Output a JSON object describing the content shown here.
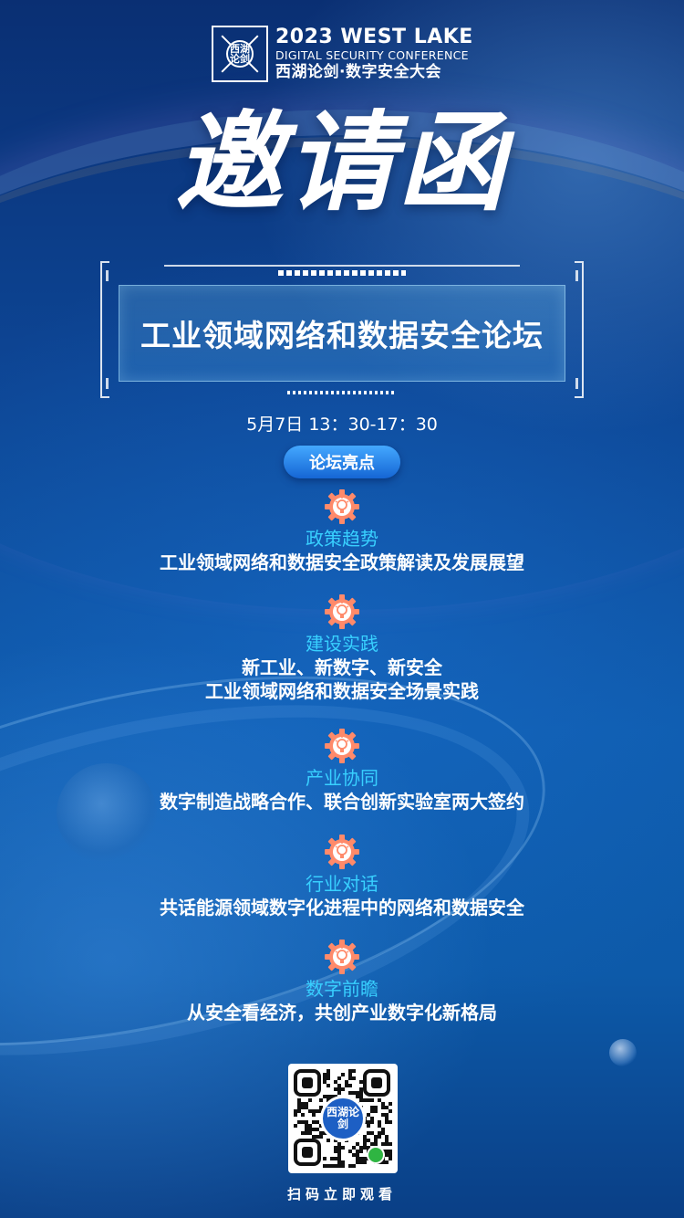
{
  "header": {
    "year": "2023",
    "line1_rest": "WEST LAKE",
    "line2": "DIGITAL SECURITY CONFERENCE",
    "line3": "西湖论剑·数字安全大会",
    "logo_text": "西湖论剑"
  },
  "main_title": "邀请函",
  "forum": {
    "title": "工业领域网络和数据安全论坛",
    "datetime": "5月7日 13：30-17：30",
    "highlights_label": "论坛亮点"
  },
  "highlights": [
    {
      "category": "政策趋势",
      "lines": [
        "工业领域网络和数据安全政策解读及发展展望"
      ]
    },
    {
      "category": "建设实践",
      "lines": [
        "新工业、新数字、新安全",
        "工业领域网络和数据安全场景实践"
      ]
    },
    {
      "category": "产业协同",
      "lines": [
        "数字制造战略合作、联合创新实验室两大签约"
      ]
    },
    {
      "category": "行业对话",
      "lines": [
        "共话能源领域数字化进程中的网络和数据安全"
      ]
    },
    {
      "category": "数字前瞻",
      "lines": [
        "从安全看经济，共创产业数字化新格局"
      ]
    }
  ],
  "qr": {
    "center_text": "西湖论剑",
    "caption": "扫码立即观看"
  },
  "colors": {
    "accent_cyan": "#38d0ff",
    "pill_blue": "#1566d4",
    "gear_orange": "#ff8a6a",
    "background": "#0d4594"
  },
  "icons": [
    "gear-bulb-icon",
    "qr-code-icon",
    "wechat-miniprogram-icon"
  ]
}
